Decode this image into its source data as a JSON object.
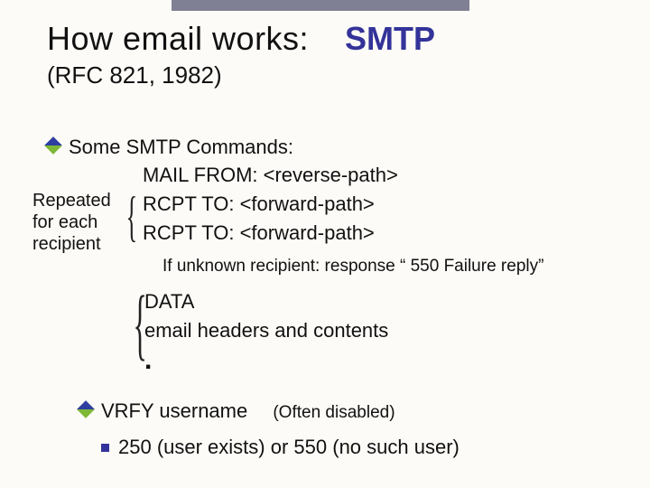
{
  "title": {
    "main": "How email works:",
    "smtp": "SMTP",
    "sub": "(RFC 821, 1982)"
  },
  "line_some": "Some SMTP Commands:",
  "cmds": {
    "mail": "MAIL  FROM: <reverse-path>",
    "rcpt1": "RCPT  TO: <forward-path>",
    "rcpt2": "RCPT  TO: <forward-path>"
  },
  "brace_label": {
    "l1": "Repeated",
    "l2": "for each",
    "l3": "recipient"
  },
  "unknown_note": "If unknown recipient:  response “ 550 Failure reply”",
  "data_block": {
    "l1": "DATA",
    "l2": "email headers and contents",
    "dot": "."
  },
  "vrfy": {
    "cmd": "VRFY",
    "arg": " username",
    "note": "(Often disabled)"
  },
  "resp": {
    "a": "250 (user exists)",
    "or": "   or   ",
    "b": "550 (no such user)"
  }
}
